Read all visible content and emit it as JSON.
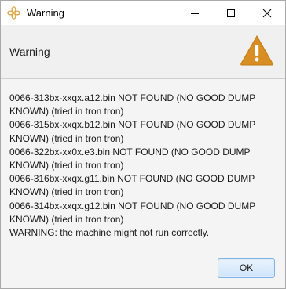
{
  "window": {
    "title": "Warning",
    "app_icon": "flower-icon",
    "controls": [
      "minimize-icon",
      "maximize-icon",
      "close-icon"
    ]
  },
  "header": {
    "title": "Warning",
    "icon": "warning-triangle-icon"
  },
  "message": {
    "lines": [
      "0066-313bx-xxqx.a12.bin NOT FOUND (NO GOOD DUMP",
      "KNOWN) (tried in tron tron)",
      "0066-315bx-xxqx.b12.bin NOT FOUND (NO GOOD DUMP",
      "KNOWN) (tried in tron tron)",
      "0066-322bx-xx0x.e3.bin NOT FOUND (NO GOOD DUMP",
      "KNOWN) (tried in tron tron)",
      "0066-316bx-xxqx.g11.bin NOT FOUND (NO GOOD DUMP",
      "KNOWN) (tried in tron tron)",
      "0066-314bx-xxqx.g12.bin NOT FOUND (NO GOOD DUMP",
      "KNOWN) (tried in tron tron)",
      "WARNING: the machine might not run correctly."
    ]
  },
  "buttons": {
    "ok_label": "OK"
  },
  "colors": {
    "warning_fill": "#d98e24",
    "ok_border": "#7eb4ea",
    "header_bg": "#f0f0f0"
  }
}
